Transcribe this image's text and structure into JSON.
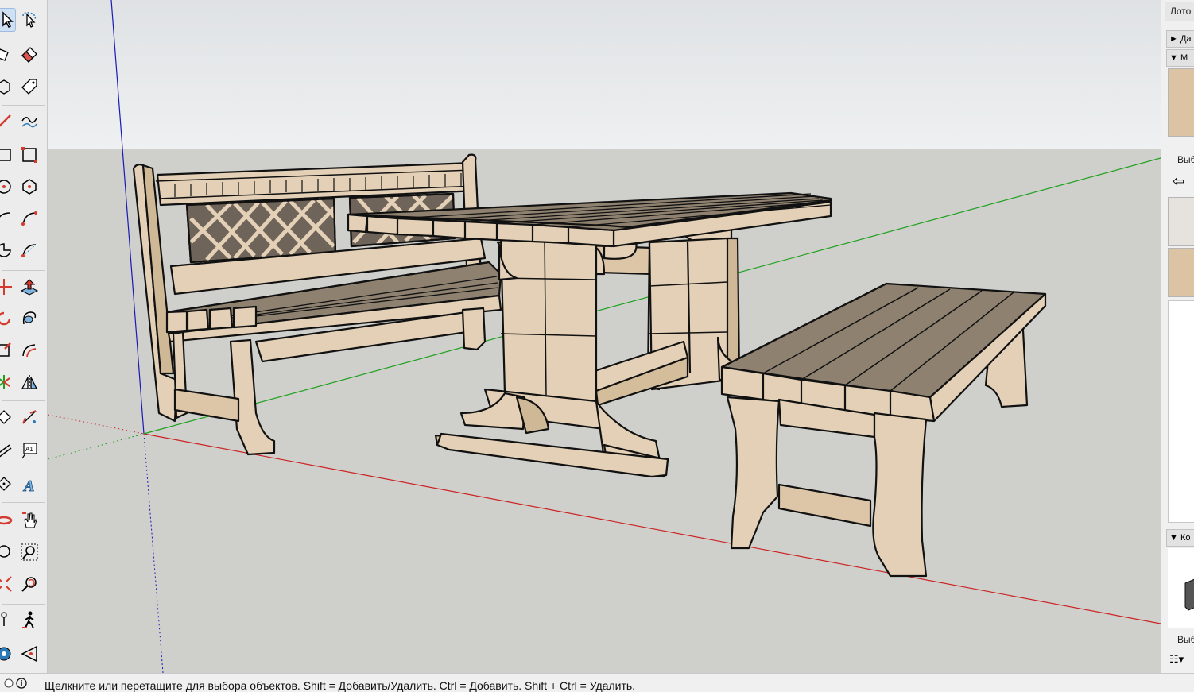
{
  "toolbar": {
    "tools": [
      {
        "name": "select-tool-icon",
        "active": true
      },
      {
        "name": "lasso-select-tool-icon"
      },
      {
        "name": "paint-bucket-tool-icon"
      },
      {
        "name": "eraser-tool-icon"
      },
      {
        "name": "make-component-icon"
      },
      {
        "name": "tag-tool-icon"
      },
      {
        "name": "line-tool-icon"
      },
      {
        "name": "freehand-tool-icon"
      },
      {
        "name": "rectangle-tool-icon"
      },
      {
        "name": "rotated-rectangle-tool-icon"
      },
      {
        "name": "circle-tool-icon"
      },
      {
        "name": "polygon-tool-icon"
      },
      {
        "name": "arc-tool-icon"
      },
      {
        "name": "two-point-arc-tool-icon"
      },
      {
        "name": "pie-tool-icon"
      },
      {
        "name": "three-point-arc-tool-icon"
      },
      {
        "name": "move-tool-icon"
      },
      {
        "name": "push-pull-tool-icon"
      },
      {
        "name": "rotate-tool-icon"
      },
      {
        "name": "follow-me-tool-icon"
      },
      {
        "name": "scale-tool-icon"
      },
      {
        "name": "offset-tool-icon"
      },
      {
        "name": "flip-tool-icon"
      },
      {
        "name": "mirror-tool-icon"
      },
      {
        "name": "tape-measure-tool-icon"
      },
      {
        "name": "dimension-tool-icon"
      },
      {
        "name": "protractor-tool-icon"
      },
      {
        "name": "text-tool-icon"
      },
      {
        "name": "axes-tool-icon"
      },
      {
        "name": "3d-text-tool-icon"
      },
      {
        "name": "orbit-tool-icon"
      },
      {
        "name": "pan-tool-icon"
      },
      {
        "name": "zoom-tool-icon"
      },
      {
        "name": "zoom-window-tool-icon"
      },
      {
        "name": "zoom-extents-tool-icon"
      },
      {
        "name": "previous-view-tool-icon"
      },
      {
        "name": "position-camera-tool-icon"
      },
      {
        "name": "walk-tool-icon"
      },
      {
        "name": "look-around-tool-icon"
      },
      {
        "name": "section-plane-tool-icon"
      }
    ],
    "text_tool_label": "A1",
    "3d_text_label": "A"
  },
  "right_panel": {
    "title": "Лото",
    "section_1": "Да",
    "section_2": "М",
    "select_label": "Выб",
    "section_3": "Ко",
    "select_label_2": "Выб",
    "colors": {
      "wood_light": "#e9d3b8",
      "wood_mid": "#d9bd9c",
      "gray_swatch": "#e6e3df"
    }
  },
  "viewport": {
    "colors": {
      "sky": "#e6e8ea",
      "ground": "#cfcfcc",
      "axis_red": "#cc2222",
      "axis_green": "#1da11d",
      "axis_blue": "#1a1ab8",
      "wood": "#e3d0b6",
      "wood_dark": "#c8b291",
      "plank_top": "#8e8170",
      "outline": "#111111"
    }
  },
  "status_bar": {
    "text": "Щелкните или перетащите для выбора объектов. Shift = Добавить/Удалить. Ctrl = Добавить. Shift + Ctrl = Удалить."
  }
}
